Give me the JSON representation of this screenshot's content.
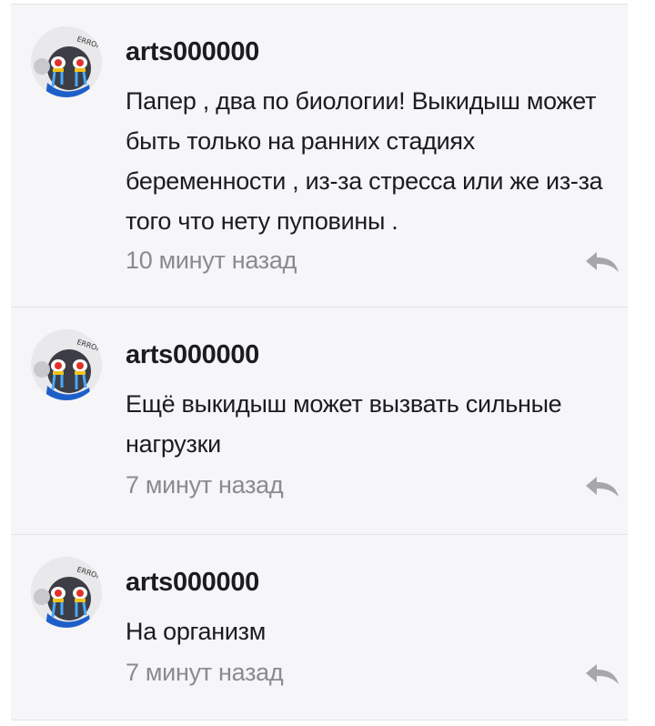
{
  "comments": [
    {
      "username": "arts000000",
      "text": "Папер , два по биологии! Выкидыш может быть только на ранних стадиях беременности , из-за стресса или же из-за того что нету пуповины .",
      "time": "10 минут назад",
      "avatar_icon": "cartoon-avatar-icon",
      "reply_icon": "reply-arrow-icon"
    },
    {
      "username": "arts000000",
      "text": "Ещё выкидыш может вызвать сильные нагрузки",
      "time": "7 минут назад",
      "avatar_icon": "cartoon-avatar-icon",
      "reply_icon": "reply-arrow-icon"
    },
    {
      "username": "arts000000",
      "text": "На организм",
      "time": "7 минут назад",
      "avatar_icon": "cartoon-avatar-icon",
      "reply_icon": "reply-arrow-icon"
    }
  ],
  "colors": {
    "background": "#ffffff",
    "card": "#f6f5f7",
    "text": "#1c1c1e",
    "muted": "#8b8a8f",
    "avatar_blue": "#1d5fc9"
  }
}
